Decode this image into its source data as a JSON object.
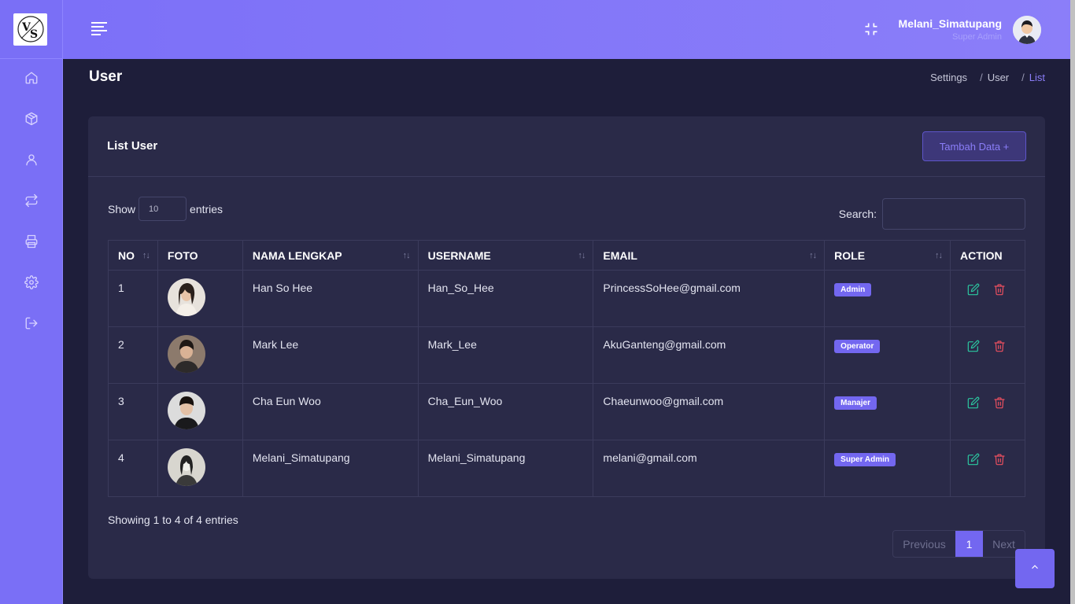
{
  "header": {
    "user_name": "Melani_Simatupang",
    "user_role": "Super Admin"
  },
  "sidebar": {
    "items": [
      {
        "icon": "home-icon"
      },
      {
        "icon": "box-icon"
      },
      {
        "icon": "user-icon"
      },
      {
        "icon": "repeat-icon"
      },
      {
        "icon": "printer-icon"
      },
      {
        "icon": "gear-icon"
      },
      {
        "icon": "logout-icon"
      }
    ]
  },
  "page": {
    "title": "User",
    "breadcrumb": [
      "Settings",
      "User",
      "List"
    ]
  },
  "card": {
    "title": "List User",
    "add_button": "Tambah Data +"
  },
  "table_controls": {
    "show_label": "Show",
    "entries_value": "10",
    "entries_label": "entries",
    "search_label": "Search:",
    "search_value": ""
  },
  "table": {
    "columns": [
      "NO",
      "FOTO",
      "NAMA LENGKAP",
      "USERNAME",
      "EMAIL",
      "ROLE",
      "ACTION"
    ],
    "rows": [
      {
        "no": "1",
        "name": "Han So Hee",
        "username": "Han_So_Hee",
        "email": "PrincessSoHee@gmail.com",
        "role": "Admin"
      },
      {
        "no": "2",
        "name": "Mark Lee",
        "username": "Mark_Lee",
        "email": "AkuGanteng@gmail.com",
        "role": "Operator"
      },
      {
        "no": "3",
        "name": "Cha Eun Woo",
        "username": "Cha_Eun_Woo",
        "email": "Chaeunwoo@gmail.com",
        "role": "Manajer"
      },
      {
        "no": "4",
        "name": "Melani_Simatupang",
        "username": "Melani_Simatupang",
        "email": "melani@gmail.com",
        "role": "Super Admin"
      }
    ]
  },
  "footer": {
    "info": "Showing 1 to 4 of 4 entries",
    "prev": "Previous",
    "page": "1",
    "next": "Next"
  },
  "colors": {
    "accent": "#7367f0",
    "sidebar": "#7a6ff6",
    "background": "#1e1e3a",
    "card": "#2a2a48",
    "edit": "#2bc7a0",
    "delete": "#ea4f5f"
  }
}
